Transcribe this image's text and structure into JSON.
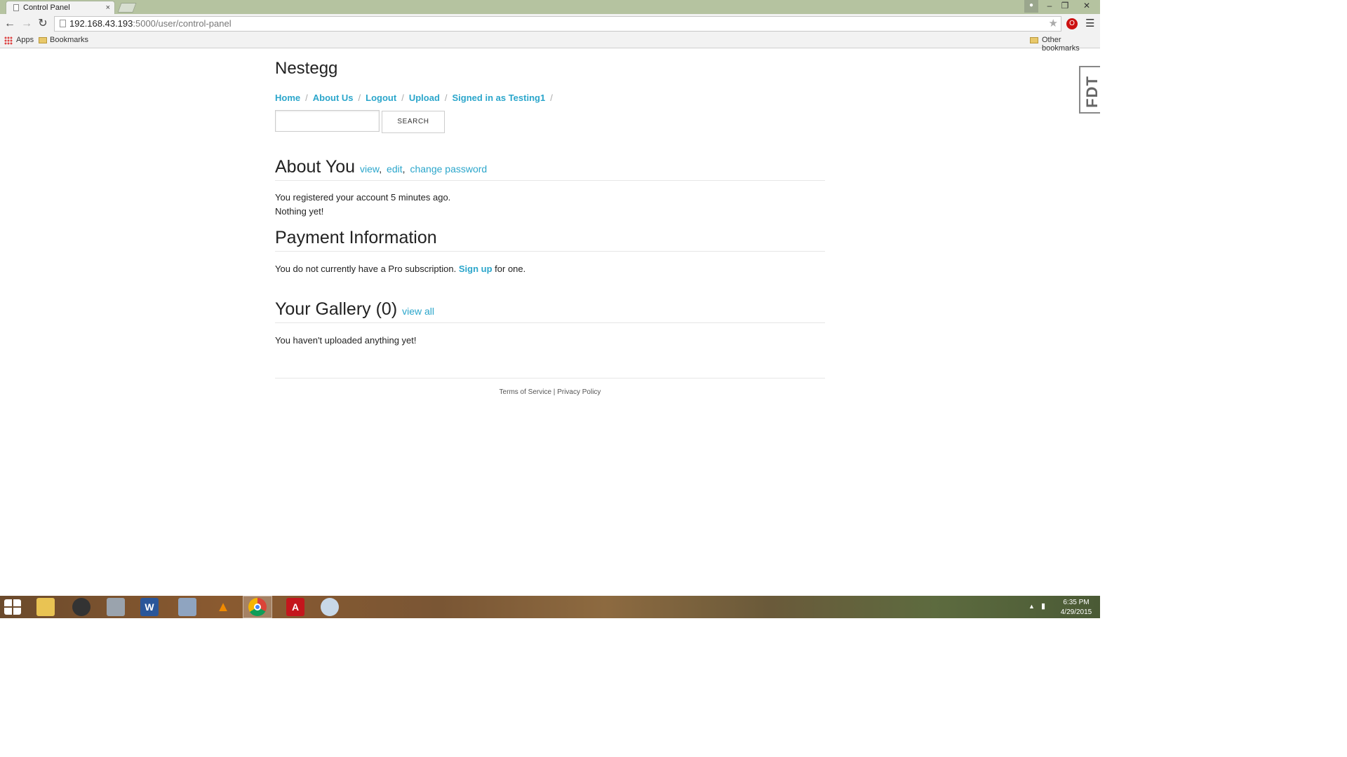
{
  "browser": {
    "tab_title": "Control Panel",
    "tab_close": "×",
    "url_host": "192.168.43.193",
    "url_path": ":5000/user/control-panel",
    "bookmarks": {
      "apps": "Apps",
      "bookmarks": "Bookmarks",
      "other": "Other bookmarks"
    }
  },
  "site": {
    "title": "Nestegg",
    "nav": [
      {
        "label": "Home"
      },
      {
        "label": "About Us"
      },
      {
        "label": "Logout"
      },
      {
        "label": "Upload"
      },
      {
        "label": "Signed in as Testing1"
      }
    ],
    "search": {
      "button": "SEARCH",
      "value": ""
    }
  },
  "about": {
    "heading": "About You",
    "link_view": "view",
    "link_edit": "edit",
    "link_change_password": "change password",
    "registered": "You registered your account 5 minutes ago.",
    "nothing": "Nothing yet!"
  },
  "payment": {
    "heading": "Payment Information",
    "text_before": "You do not currently have a Pro subscription.",
    "link_signup": "Sign up",
    "text_after": "for one."
  },
  "gallery": {
    "heading": "Your Gallery (0)",
    "link_view_all": "view all",
    "empty": "You haven't uploaded anything yet!"
  },
  "footer": {
    "terms": "Terms of Service",
    "separator": "|",
    "privacy": "Privacy Policy"
  },
  "side_tab": {
    "label": "FDT"
  },
  "taskbar": {
    "time": "6:35 PM",
    "date": "4/29/2015"
  }
}
